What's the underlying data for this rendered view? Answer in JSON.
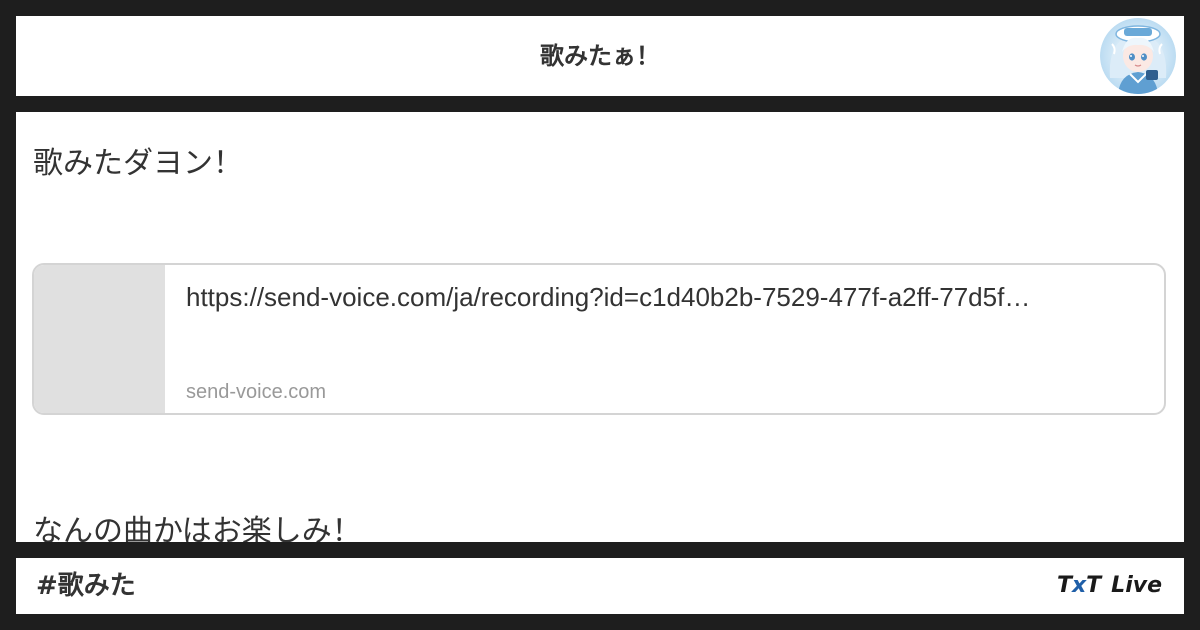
{
  "header": {
    "title": "歌みたぁ！"
  },
  "post": {
    "line1": "歌みたダヨン！",
    "line2": "なんの曲かはお楽しみ！"
  },
  "link_card": {
    "url": "https://send-voice.com/ja/recording?id=c1d40b2b-7529-477f-a2ff-77d5f…",
    "domain": "send-voice.com"
  },
  "footer": {
    "hashtag": "#歌みた",
    "brand": {
      "t1": "T",
      "x": "x",
      "t2": "T",
      "live": "Live"
    }
  },
  "colors": {
    "frame": "#1e1e1e",
    "panel": "#ffffff",
    "text": "#333333",
    "muted": "#999999",
    "thumb": "#e0e0e0",
    "brand_accent": "#1f5fa8"
  },
  "icons": {
    "avatar": "avatar-icon"
  }
}
